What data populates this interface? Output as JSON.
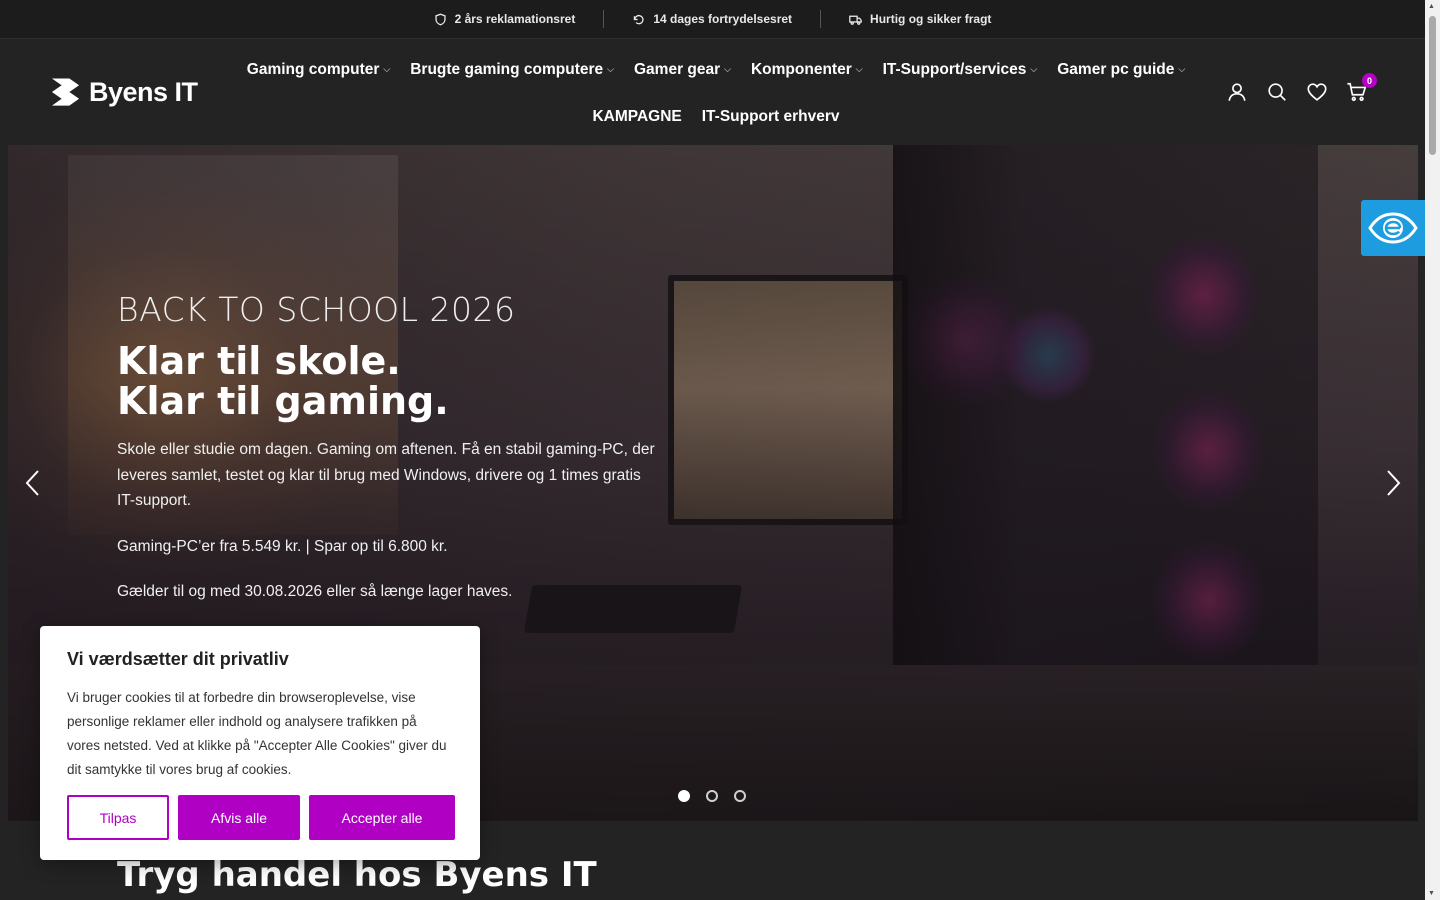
{
  "topbar": {
    "items": [
      {
        "icon": "shield-icon",
        "label": "2 års reklamationsret"
      },
      {
        "icon": "rotate-icon",
        "label": "14 dages fortrydelsesret"
      },
      {
        "icon": "truck-icon",
        "label": "Hurtig og sikker fragt"
      }
    ]
  },
  "header": {
    "logo_text": "Byens IT",
    "nav": [
      {
        "label": "Gaming computer",
        "has_dropdown": true
      },
      {
        "label": "Brugte gaming computere",
        "has_dropdown": true
      },
      {
        "label": "Gamer gear",
        "has_dropdown": true
      },
      {
        "label": "Komponenter",
        "has_dropdown": true
      },
      {
        "label": "IT-Support/services",
        "has_dropdown": true
      },
      {
        "label": "Gamer pc guide",
        "has_dropdown": true
      },
      {
        "label": "KAMPAGNE",
        "has_dropdown": false
      },
      {
        "label": "IT-Support erhverv",
        "has_dropdown": false
      }
    ],
    "cart_count": "0",
    "icons": [
      "user-icon",
      "search-icon",
      "heart-icon",
      "cart-icon"
    ]
  },
  "hero": {
    "eyebrow": "BACK TO SCHOOL 2026",
    "title_line1": "Klar til skole.",
    "title_line2": "Klar til gaming.",
    "paragraph1": "Skole eller studie om dagen. Gaming om aftenen. Få en stabil gaming-PC, der leveres samlet, testet og klar til brug med Windows, drivere og 1 times gratis IT-support.",
    "paragraph2": "Gaming-PC’er fra 5.549 kr. | Spar op til 6.800 kr.",
    "paragraph3": "Gælder til og med 30.08.2026 eller så længe lager haves.",
    "slides": 3,
    "active_slide": 1
  },
  "section": {
    "title": "Tryg handel hos Byens IT"
  },
  "cookie": {
    "title": "Vi værdsætter dit privatliv",
    "body": "Vi bruger cookies til at forbedre din browseroplevelse, vise personlige reklamer eller indhold og analysere trafikken på vores netsted. Ved at klikke på \"Accepter Alle Cookies\" giver du dit samtykke til vores brug af cookies.",
    "customize_label": "Tilpas",
    "reject_label": "Afvis alle",
    "accept_label": "Accepter alle"
  },
  "colors": {
    "brand_purple": "#b000c4",
    "accessibility_blue": "#1e9ce0",
    "dark_bg": "#232323"
  }
}
